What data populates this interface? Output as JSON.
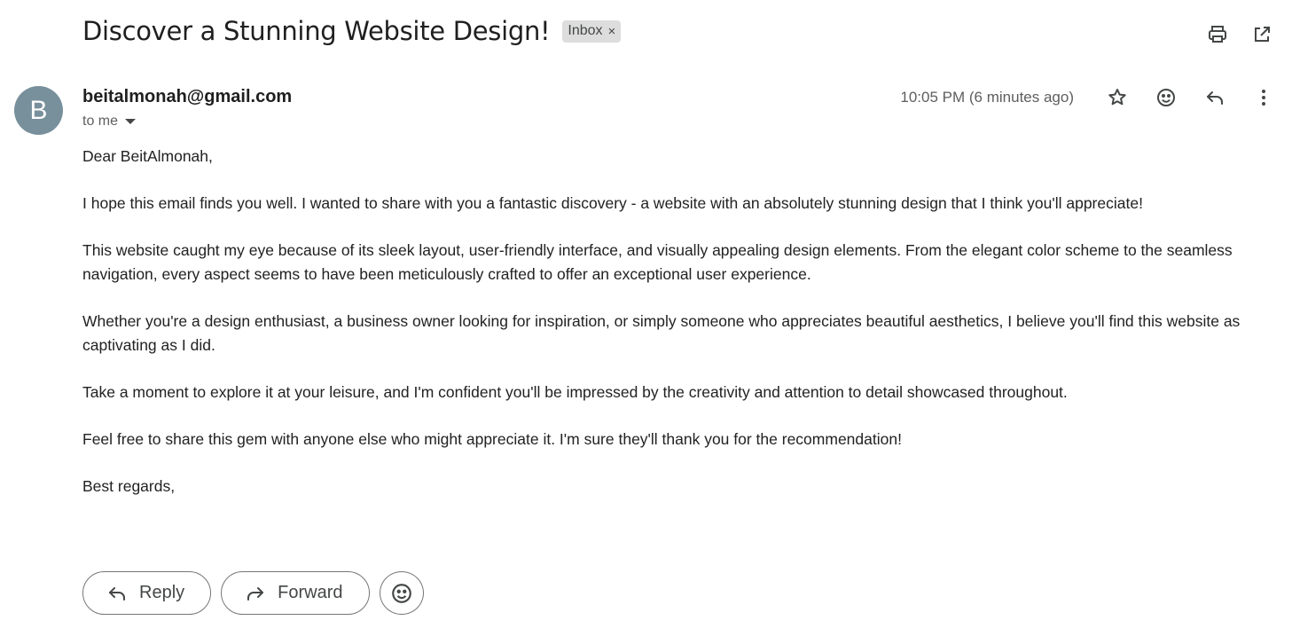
{
  "email": {
    "subject": "Discover a Stunning Website Design!",
    "label": {
      "text": "Inbox",
      "remove_glyph": "×"
    },
    "sender": {
      "initial": "B",
      "address": "beitalmonah@gmail.com",
      "avatar_color": "#78909c"
    },
    "recipient_text": "to me",
    "timestamp": "10:05 PM (6 minutes ago)",
    "body": [
      "Dear BeitAlmonah,",
      "I hope this email finds you well. I wanted to share with you a fantastic discovery - a website with an absolutely stunning design that I think you'll appreciate!",
      "This website caught my eye because of its sleek layout, user-friendly interface, and visually appealing design elements. From the elegant color scheme to the seamless navigation, every aspect seems to have been meticulously crafted to offer an exceptional user experience.",
      "Whether you're a design enthusiast, a business owner looking for inspiration, or simply someone who appreciates beautiful aesthetics, I believe you'll find this website as captivating as I did.",
      "Take a moment to explore it at your leisure, and I'm confident you'll be impressed by the creativity and attention to detail showcased throughout.",
      "Feel free to share this gem with anyone else who might appreciate it. I'm sure they'll thank you for the recommendation!",
      "Best regards,"
    ]
  },
  "toolbar": {
    "top_icons": [
      "print-icon",
      "open-in-new-window-icon"
    ],
    "message_icons": [
      "star-icon",
      "emoji-reaction-icon",
      "reply-icon",
      "more-vertical-icon"
    ]
  },
  "actions": {
    "reply_label": "Reply",
    "forward_label": "Forward"
  }
}
